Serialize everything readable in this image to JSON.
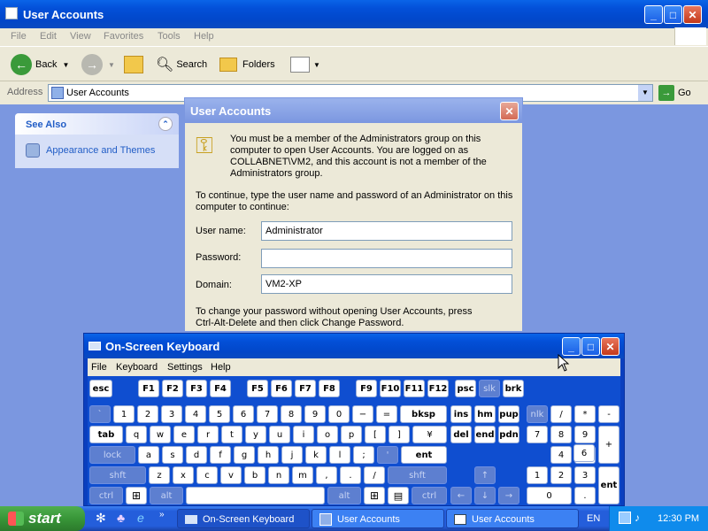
{
  "explorer": {
    "title": "User Accounts",
    "menu": [
      "File",
      "Edit",
      "View",
      "Favorites",
      "Tools",
      "Help"
    ],
    "toolbar": {
      "back": "Back",
      "search": "Search",
      "folders": "Folders"
    },
    "address": {
      "label": "Address",
      "value": "User Accounts",
      "go": "Go"
    },
    "see_also": {
      "title": "See Also",
      "item": "Appearance and Themes"
    }
  },
  "dialog": {
    "title": "User Accounts",
    "message_lines": [
      "You must be a member of the Administrators group on this",
      "computer to open User Accounts.  You are logged on as",
      "COLLABNET\\VM2, and this account is not a member of the",
      "Administrators group."
    ],
    "instruction_lines": [
      "To continue, type the user name and password of an Administrator on this",
      "computer to continue:"
    ],
    "username_label": "User name:",
    "username_value": "Administrator",
    "password_label": "Password:",
    "password_value": "",
    "domain_label": "Domain:",
    "domain_value": "VM2-XP",
    "footer_lines": [
      "To change your password without opening User Accounts, press",
      "Ctrl-Alt-Delete and then click Change Password."
    ]
  },
  "osk": {
    "title": "On-Screen Keyboard",
    "menu": [
      "File",
      "Keyboard",
      "Settings",
      "Help"
    ],
    "keys": {
      "esc": "esc",
      "f1": "F1",
      "f2": "F2",
      "f3": "F3",
      "f4": "F4",
      "f5": "F5",
      "f6": "F6",
      "f7": "F7",
      "f8": "F8",
      "f9": "F9",
      "f10": "F10",
      "f11": "F11",
      "f12": "F12",
      "psc": "psc",
      "slk": "slk",
      "brk": "brk",
      "r1": [
        "`",
        "1",
        "2",
        "3",
        "4",
        "5",
        "6",
        "7",
        "8",
        "9",
        "0",
        "−",
        "="
      ],
      "bksp": "bksp",
      "ins": "ins",
      "hm": "hm",
      "pup": "pup",
      "nlk": "nlk",
      "n_div": "/",
      "n_mul": "*",
      "n_sub": "-",
      "tab": "tab",
      "r2": [
        "q",
        "w",
        "e",
        "r",
        "t",
        "y",
        "u",
        "i",
        "o",
        "p",
        "[",
        "]",
        "¥"
      ],
      "del": "del",
      "end": "end",
      "pdn": "pdn",
      "n7": "7",
      "n8": "8",
      "n9": "9",
      "n_add": "+",
      "lock": "lock",
      "r3": [
        "a",
        "s",
        "d",
        "f",
        "g",
        "h",
        "j",
        "k",
        "l",
        ";",
        "'"
      ],
      "ent": "ent",
      "n4": "4",
      "n5": "5",
      "n6": "6",
      "shft": "shft",
      "r4": [
        "z",
        "x",
        "c",
        "v",
        "b",
        "n",
        "m",
        ",",
        ".",
        "/"
      ],
      "shft_r": "shft",
      "up": "↑",
      "n1": "1",
      "n2": "2",
      "n3": "3",
      "ctrl": "ctrl",
      "alt": "alt",
      "alt_r": "alt",
      "ctrl_r": "ctrl",
      "left": "←",
      "down": "↓",
      "right": "→",
      "n0": "0",
      "n_dot": ".",
      "n_ent": "ent"
    }
  },
  "taskbar": {
    "start": "start",
    "tasks": [
      "On-Screen Keyboard",
      "User Accounts",
      "User Accounts"
    ],
    "lang": "EN",
    "clock": "12:30 PM"
  }
}
